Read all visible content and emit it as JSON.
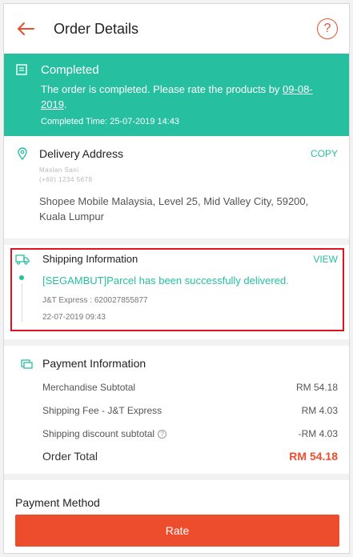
{
  "header": {
    "title": "Order Details",
    "help_icon": "question-circle-icon",
    "back_icon": "arrow-left-icon"
  },
  "status": {
    "title": "Completed",
    "message_prefix": "The order is completed. Please rate the products by ",
    "date": "09-08-2019",
    "message_suffix": ".",
    "completed_time": "Completed Time: 25-07-2019 14:43",
    "color": "#26bfa0"
  },
  "delivery": {
    "heading": "Delivery Address",
    "action": "COPY",
    "name": "Maslan Sani",
    "phone": "(+60) 1234 5678",
    "address": "Shopee Mobile Malaysia, Level 25, Mid Valley City, 59200, Kuala Lumpur"
  },
  "shipping": {
    "heading": "Shipping Information",
    "action": "VIEW",
    "message": "[SEGAMBUT]Parcel has been successfully delivered.",
    "courier": "J&T Express :  620027855877",
    "time": "22-07-2019 09:43"
  },
  "payment": {
    "heading": "Payment Information",
    "rows": [
      {
        "label": "Merchandise Subtotal",
        "value": "RM 54.18"
      },
      {
        "label": "Shipping Fee - J&T Express",
        "value": "RM 4.03"
      },
      {
        "label": "Shipping discount subtotal",
        "value": "-RM 4.03"
      }
    ],
    "total_label": "Order Total",
    "total_value": "RM 54.18"
  },
  "payment_method": {
    "heading": "Payment Method"
  },
  "actions": {
    "rate": "Rate"
  },
  "colors": {
    "accent": "#ee4d2d",
    "teal": "#26bfa0",
    "highlight_border": "#e0121f"
  }
}
